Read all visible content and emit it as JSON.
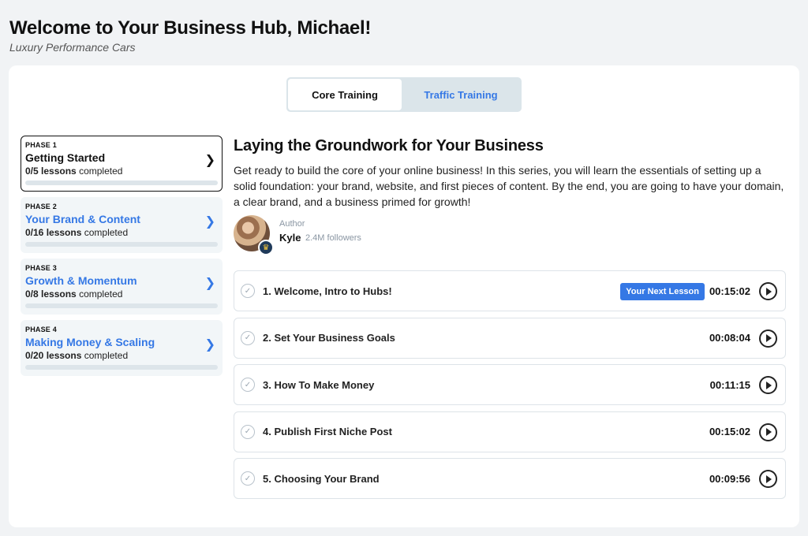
{
  "header": {
    "title": "Welcome to Your Business Hub, Michael!",
    "subtitle": "Luxury Performance Cars"
  },
  "tabs": [
    {
      "label": "Core Training",
      "active": true
    },
    {
      "label": "Traffic Training",
      "active": false
    }
  ],
  "phases": [
    {
      "tag": "PHASE 1",
      "name": "Getting Started",
      "count": "0/5",
      "suffix": "lessons",
      "rest": "completed",
      "progress": 0,
      "active": true
    },
    {
      "tag": "PHASE 2",
      "name": "Your Brand & Content",
      "count": "0/16",
      "suffix": "lessons",
      "rest": "completed",
      "progress": 0,
      "active": false
    },
    {
      "tag": "PHASE 3",
      "name": "Growth & Momentum",
      "count": "0/8",
      "suffix": "lessons",
      "rest": "completed",
      "progress": 0,
      "active": false
    },
    {
      "tag": "PHASE 4",
      "name": "Making Money & Scaling",
      "count": "0/20",
      "suffix": "lessons",
      "rest": "completed",
      "progress": 0,
      "active": false
    }
  ],
  "content": {
    "title": "Laying the Groundwork for Your Business",
    "description": "Get ready to build the core of your online business! In this series, you will learn the essentials of setting up a solid foundation: your brand, website, and first pieces of content. By the end, you are going to have your domain, a clear brand, and a business primed for growth!",
    "author": {
      "label": "Author",
      "name": "Kyle",
      "followers": "2.4M followers"
    }
  },
  "lessons": [
    {
      "title": "1. Welcome, Intro to Hubs!",
      "duration": "00:15:02",
      "badge": "Your Next Lesson"
    },
    {
      "title": "2. Set Your Business Goals",
      "duration": "00:08:04"
    },
    {
      "title": "3. How To Make Money",
      "duration": "00:11:15"
    },
    {
      "title": "4. Publish First Niche Post",
      "duration": "00:15:02"
    },
    {
      "title": "5. Choosing Your Brand",
      "duration": "00:09:56"
    }
  ],
  "colors": {
    "accent": "#3578e5",
    "background": "#f1f3f5",
    "tab_track": "#dbe5ea",
    "phase_background": "#f2f6f8"
  },
  "icons": {
    "phase_chevron": "chevron-right-icon",
    "lesson_check": "check-circle-icon",
    "lesson_play": "play-circle-icon",
    "author_badge": "crown-icon"
  }
}
